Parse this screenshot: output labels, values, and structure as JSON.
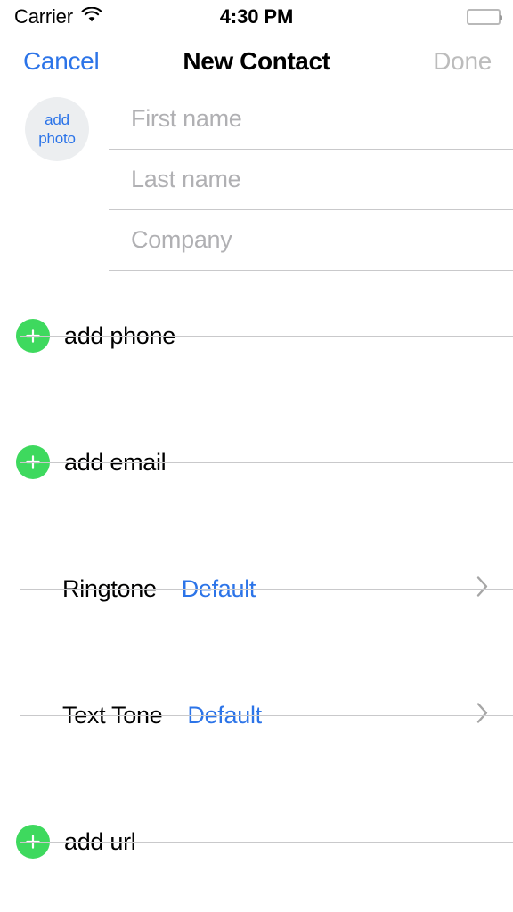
{
  "status_bar": {
    "carrier": "Carrier",
    "wifi_icon": "wifi-icon",
    "time": "4:30 PM",
    "battery_icon": "battery-full-icon"
  },
  "nav_bar": {
    "cancel_label": "Cancel",
    "title": "New Contact",
    "done_label": "Done",
    "done_enabled": false
  },
  "avatar": {
    "line1": "add",
    "line2": "photo"
  },
  "name_fields": [
    {
      "name": "first-name-field",
      "placeholder": "First name",
      "value": ""
    },
    {
      "name": "last-name-field",
      "placeholder": "Last name",
      "value": ""
    },
    {
      "name": "company-field",
      "placeholder": "Company",
      "value": ""
    }
  ],
  "add_rows": [
    {
      "name": "add-phone-row",
      "label": "add phone",
      "icon": "plus-circle-icon"
    },
    {
      "name": "add-email-row",
      "label": "add email",
      "icon": "plus-circle-icon"
    }
  ],
  "tone_rows": [
    {
      "name": "ringtone-row",
      "label": "Ringtone",
      "value": "Default",
      "icon": "chevron-right-icon"
    },
    {
      "name": "text-tone-row",
      "label": "Text Tone",
      "value": "Default",
      "icon": "chevron-right-icon"
    }
  ],
  "add_url_row": {
    "name": "add-url-row",
    "label": "add url",
    "icon": "plus-circle-icon"
  },
  "colors": {
    "accent_blue": "#2c74e8",
    "add_green": "#3ed95e",
    "separator": "#c9c9cb",
    "placeholder_gray": "#b0b0b3",
    "disabled_gray": "#bcbcbc",
    "avatar_bg": "#eceef0",
    "background": "#ffffff"
  }
}
